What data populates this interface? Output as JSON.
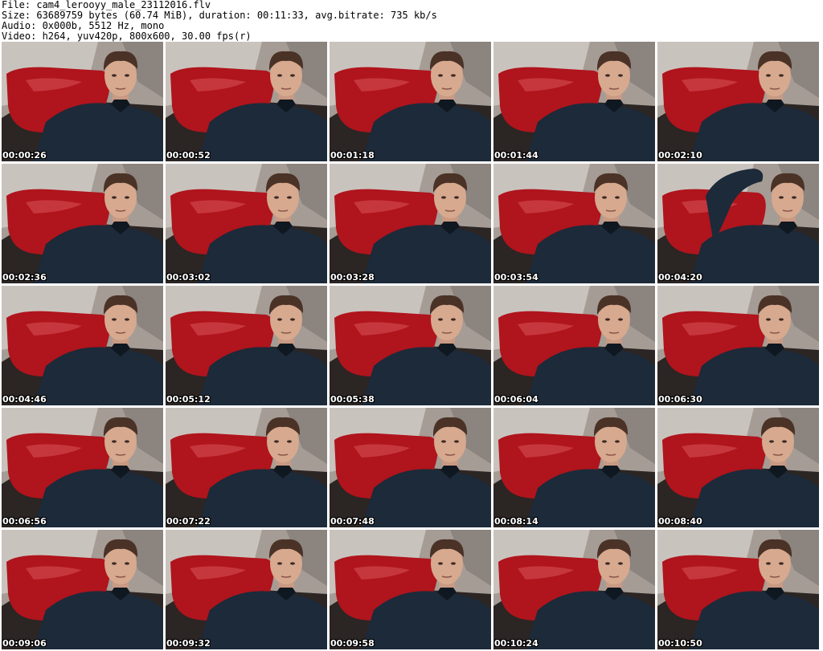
{
  "header": {
    "file_line": "File: cam4_lerooyy_male_23112016.flv",
    "size_line": "Size: 63689759 bytes (60.74 MiB), duration: 00:11:33, avg.bitrate: 735 kb/s",
    "audio_line": "Audio: 0x000b, 5512 Hz, mono",
    "video_line": "Video: h264, yuv420p, 800x600, 30.00 fps(r)"
  },
  "colors": {
    "background": "#ffffff",
    "text": "#000000",
    "timestamp_text": "#ffffff",
    "timestamp_outline": "#000000",
    "pillow_red": "#b0141c",
    "sweater_navy": "#1c2a3a",
    "wall_gray": "#c9c3be"
  },
  "thumbnails": [
    {
      "timestamp": "00:00:26",
      "variant": "normal"
    },
    {
      "timestamp": "00:00:52",
      "variant": "normal"
    },
    {
      "timestamp": "00:01:18",
      "variant": "normal"
    },
    {
      "timestamp": "00:01:44",
      "variant": "normal"
    },
    {
      "timestamp": "00:02:10",
      "variant": "normal"
    },
    {
      "timestamp": "00:02:36",
      "variant": "normal"
    },
    {
      "timestamp": "00:03:02",
      "variant": "normal"
    },
    {
      "timestamp": "00:03:28",
      "variant": "normal"
    },
    {
      "timestamp": "00:03:54",
      "variant": "normal"
    },
    {
      "timestamp": "00:04:20",
      "variant": "arm-raised"
    },
    {
      "timestamp": "00:04:46",
      "variant": "normal"
    },
    {
      "timestamp": "00:05:12",
      "variant": "normal"
    },
    {
      "timestamp": "00:05:38",
      "variant": "normal"
    },
    {
      "timestamp": "00:06:04",
      "variant": "normal"
    },
    {
      "timestamp": "00:06:30",
      "variant": "normal"
    },
    {
      "timestamp": "00:06:56",
      "variant": "normal"
    },
    {
      "timestamp": "00:07:22",
      "variant": "normal"
    },
    {
      "timestamp": "00:07:48",
      "variant": "normal"
    },
    {
      "timestamp": "00:08:14",
      "variant": "normal"
    },
    {
      "timestamp": "00:08:40",
      "variant": "normal"
    },
    {
      "timestamp": "00:09:06",
      "variant": "normal"
    },
    {
      "timestamp": "00:09:32",
      "variant": "normal"
    },
    {
      "timestamp": "00:09:58",
      "variant": "normal"
    },
    {
      "timestamp": "00:10:24",
      "variant": "normal"
    },
    {
      "timestamp": "00:10:50",
      "variant": "normal"
    }
  ]
}
